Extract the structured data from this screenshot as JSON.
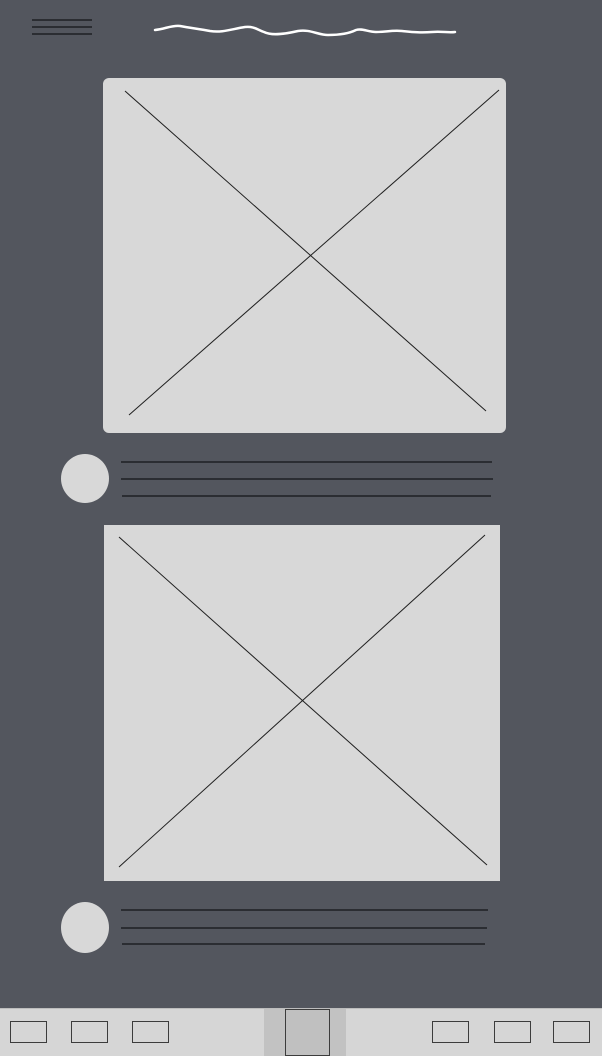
{
  "header": {
    "menu_icon": "hamburger-icon",
    "title_icon": "squiggle-title-placeholder"
  },
  "feed": {
    "posts": [
      {
        "image_icon": "image-placeholder-icon",
        "avatar_icon": "avatar-placeholder",
        "text_icon": "text-lines-placeholder"
      },
      {
        "image_icon": "image-placeholder-icon",
        "avatar_icon": "avatar-placeholder",
        "text_icon": "text-lines-placeholder"
      }
    ]
  },
  "bottom_bar": {
    "left_buttons": [
      "tab-button",
      "tab-button",
      "tab-button"
    ],
    "center_button": "center-action-button",
    "right_buttons": [
      "tab-button",
      "tab-button",
      "tab-button"
    ]
  },
  "colors": {
    "background": "#53565e",
    "placeholder": "#d8d8d8",
    "bottom_bar": "#d6d6d6",
    "center_highlight": "#c2c2c2",
    "line": "#2b2d32"
  }
}
